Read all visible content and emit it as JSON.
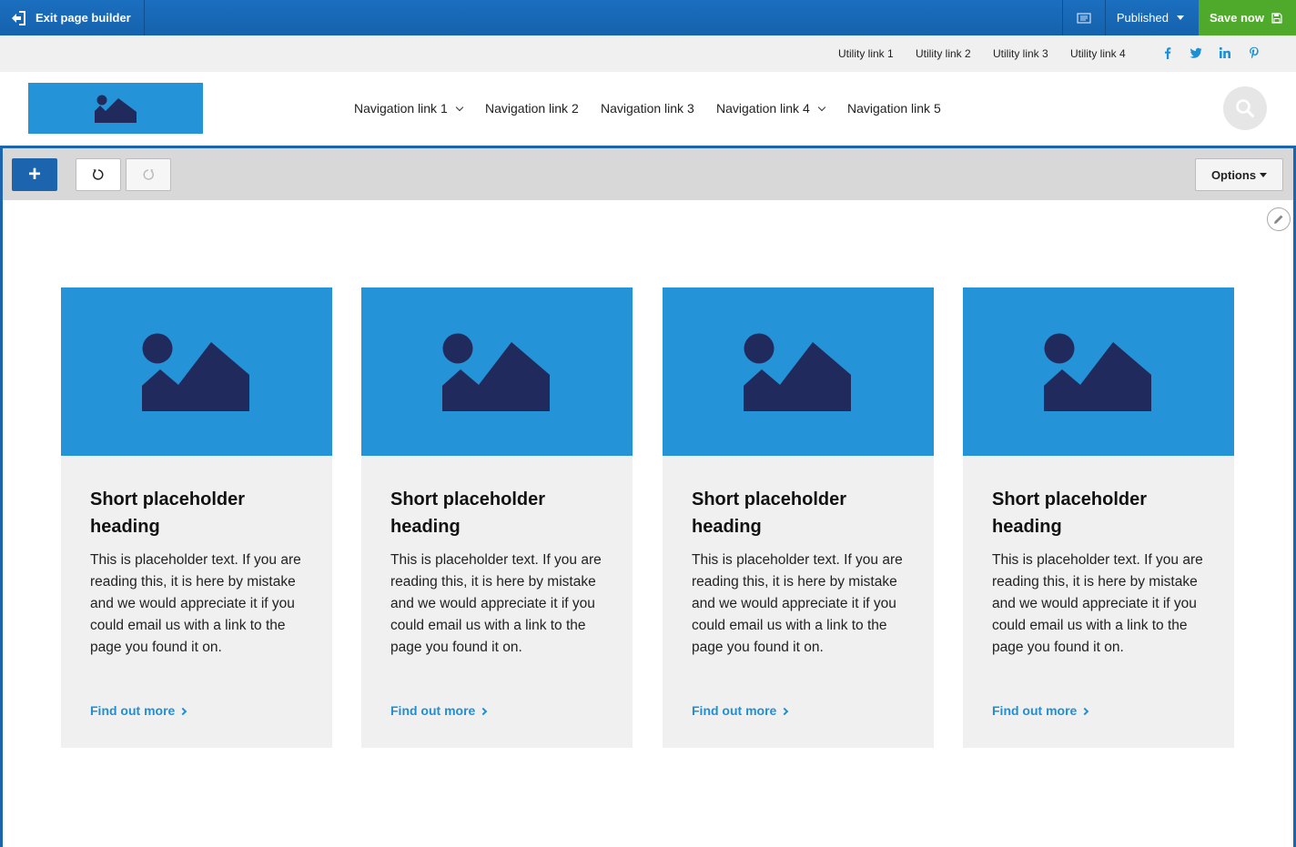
{
  "builder": {
    "exit_label": "Exit page builder",
    "status_label": "Published",
    "save_label": "Save now",
    "accent_color": "#1b6fbf",
    "save_color": "#4faa2b"
  },
  "utility": {
    "links": [
      "Utility link 1",
      "Utility link 2",
      "Utility link 3",
      "Utility link 4"
    ],
    "social_icons": [
      "facebook-icon",
      "twitter-icon",
      "linkedin-icon",
      "pinterest-icon"
    ]
  },
  "header": {
    "nav": [
      {
        "label": "Navigation link 1",
        "has_dropdown": true
      },
      {
        "label": "Navigation link 2",
        "has_dropdown": false
      },
      {
        "label": "Navigation link 3",
        "has_dropdown": false
      },
      {
        "label": "Navigation link 4",
        "has_dropdown": true
      },
      {
        "label": "Navigation link 5",
        "has_dropdown": false
      }
    ]
  },
  "toolbar": {
    "add_label": "+",
    "options_label": "Options"
  },
  "cards": [
    {
      "heading": "Short placeholder heading",
      "text": "This is placeholder text. If you are reading this, it is here by mistake and we would appreciate it if you could email us with a link to the page you found it on.",
      "link": "Find out more"
    },
    {
      "heading": "Short placeholder heading",
      "text": "This is placeholder text. If you are reading this, it is here by mistake and we would appreciate it if you could email us with a link to the page you found it on.",
      "link": "Find out more"
    },
    {
      "heading": "Short placeholder heading",
      "text": "This is placeholder text. If you are reading this, it is here by mistake and we would appreciate it if you could email us with a link to the page you found it on.",
      "link": "Find out more"
    },
    {
      "heading": "Short placeholder heading",
      "text": "This is placeholder text. If you are reading this, it is here by mistake and we would appreciate it if you could email us with a link to the page you found it on.",
      "link": "Find out more"
    }
  ]
}
